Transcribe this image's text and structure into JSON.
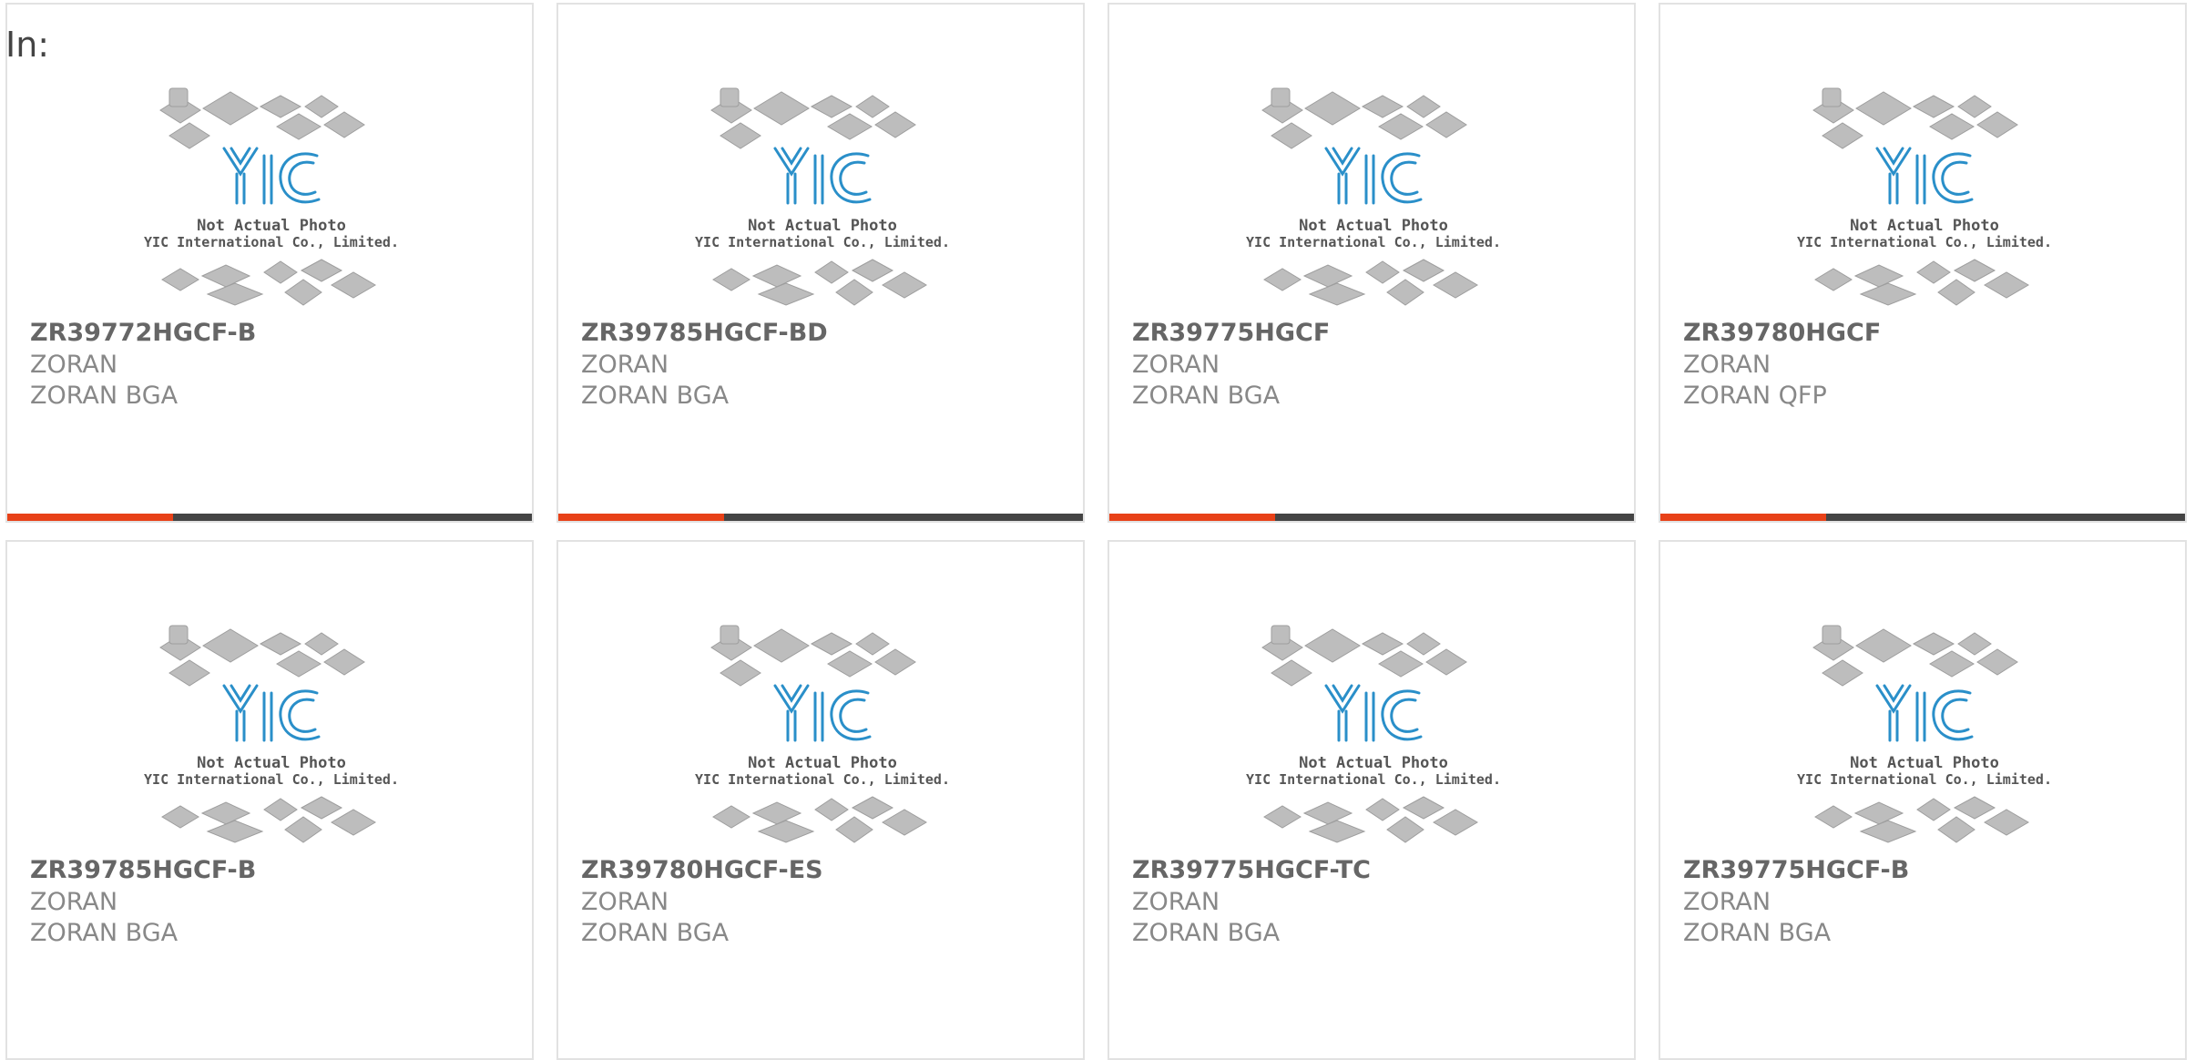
{
  "header": {
    "in_label": "In:"
  },
  "photo": {
    "caption_line1": "Not Actual Photo",
    "caption_line2": "YIC International Co., Limited.",
    "logo_text": "YIC",
    "logo_color": "#2a8fc9",
    "chip_color": "#bdbdbd"
  },
  "accent_color": "#e84118",
  "bar_color": "#444444",
  "products": [
    {
      "part": "ZR39772HGCF-B",
      "manufacturer": "ZORAN",
      "package": "ZORAN BGA"
    },
    {
      "part": "ZR39785HGCF-BD",
      "manufacturer": "ZORAN",
      "package": "ZORAN BGA"
    },
    {
      "part": "ZR39775HGCF",
      "manufacturer": "ZORAN",
      "package": "ZORAN BGA"
    },
    {
      "part": "ZR39780HGCF",
      "manufacturer": "ZORAN",
      "package": "ZORAN QFP"
    },
    {
      "part": "ZR39785HGCF-B",
      "manufacturer": "ZORAN",
      "package": "ZORAN BGA"
    },
    {
      "part": "ZR39780HGCF-ES",
      "manufacturer": "ZORAN",
      "package": "ZORAN BGA"
    },
    {
      "part": "ZR39775HGCF-TC",
      "manufacturer": "ZORAN",
      "package": "ZORAN BGA"
    },
    {
      "part": "ZR39775HGCF-B",
      "manufacturer": "ZORAN",
      "package": "ZORAN BGA"
    }
  ]
}
